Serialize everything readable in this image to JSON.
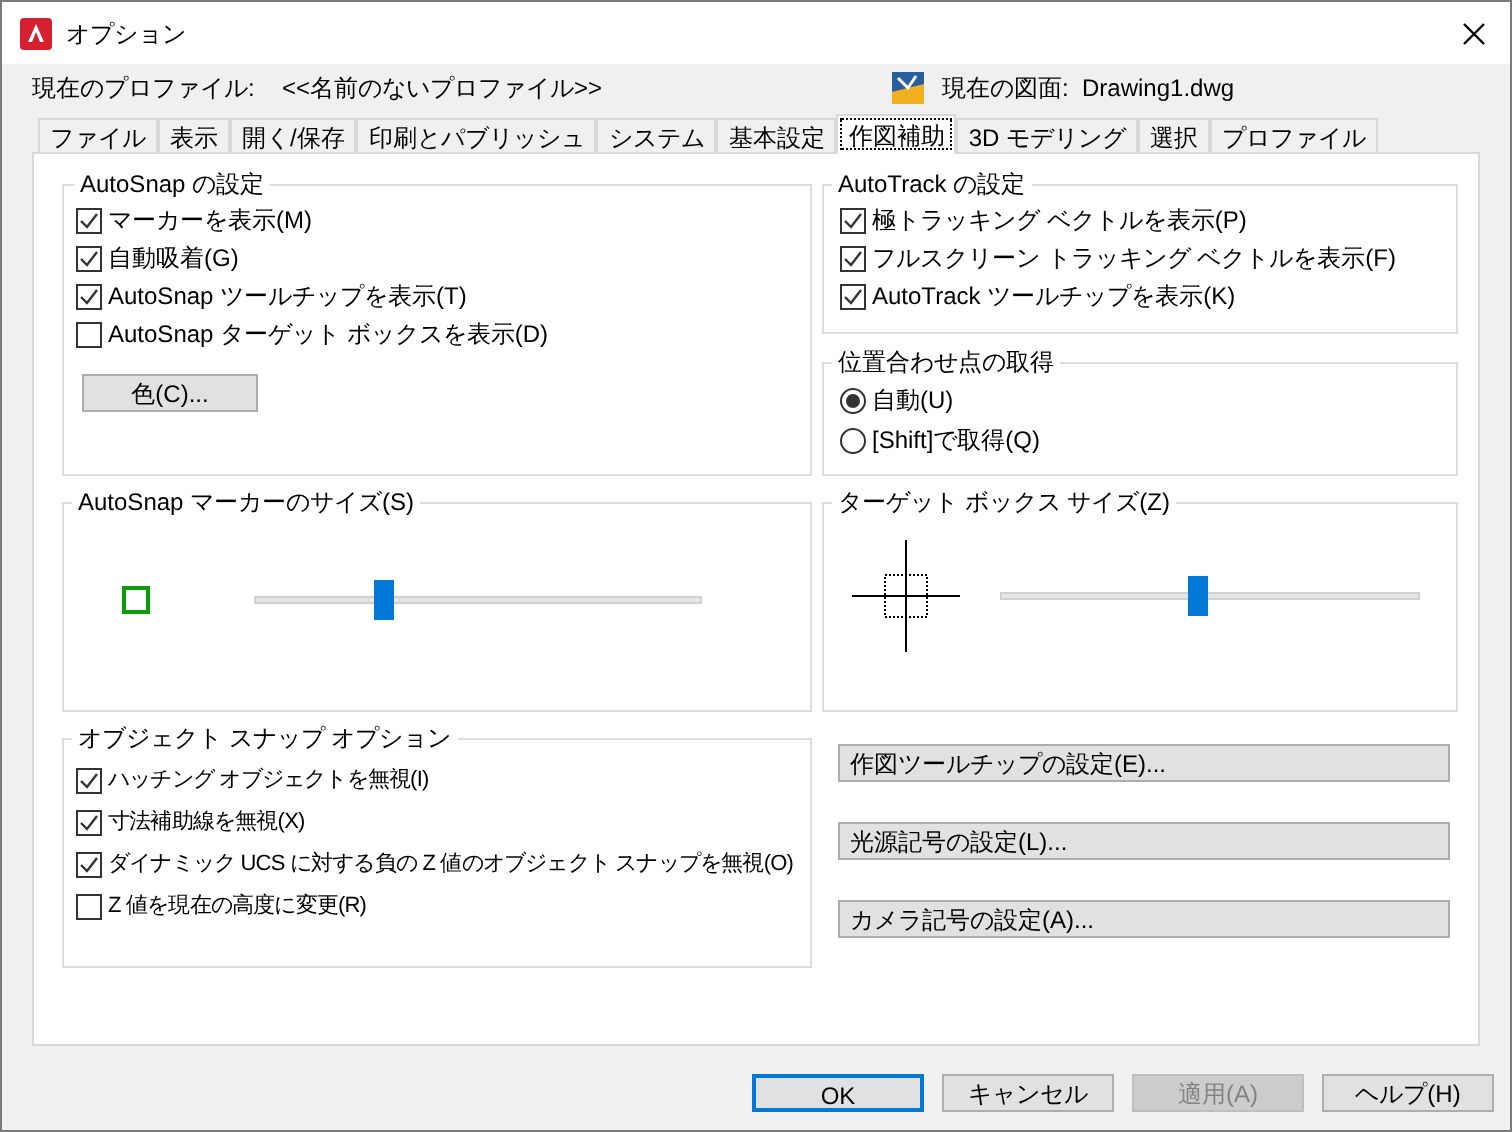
{
  "window": {
    "title": "オプション"
  },
  "profile": {
    "label": "現在のプロファイル:",
    "value": "<<名前のないプロファイル>>"
  },
  "drawing": {
    "label": "現在の図面:",
    "value": "Drawing1.dwg"
  },
  "tabs": [
    {
      "label": "ファイル",
      "selected": false
    },
    {
      "label": "表示",
      "selected": false
    },
    {
      "label": "開く/保存",
      "selected": false
    },
    {
      "label": "印刷とパブリッシュ",
      "selected": false
    },
    {
      "label": "システム",
      "selected": false
    },
    {
      "label": "基本設定",
      "selected": false
    },
    {
      "label": "作図補助",
      "selected": true
    },
    {
      "label": "3D モデリング",
      "selected": false
    },
    {
      "label": "選択",
      "selected": false
    },
    {
      "label": "プロファイル",
      "selected": false
    }
  ],
  "autosnap": {
    "title": "AutoSnap の設定",
    "options": [
      {
        "label": "マーカーを表示(M)",
        "checked": true
      },
      {
        "label": "自動吸着(G)",
        "checked": true
      },
      {
        "label": "AutoSnap ツールチップを表示(T)",
        "checked": true
      },
      {
        "label": "AutoSnap ターゲット ボックスを表示(D)",
        "checked": false
      }
    ],
    "color_button": "色(C)..."
  },
  "autotrack": {
    "title": "AutoTrack の設定",
    "options": [
      {
        "label": "極トラッキング ベクトルを表示(P)",
        "checked": true
      },
      {
        "label": "フルスクリーン トラッキング ベクトルを表示(F)",
        "checked": true
      },
      {
        "label": "AutoTrack ツールチップを表示(K)",
        "checked": true
      }
    ]
  },
  "alignment": {
    "title": "位置合わせ点の取得",
    "options": [
      {
        "label": "自動(U)",
        "selected": true
      },
      {
        "label": "[Shift]で取得(Q)",
        "selected": false
      }
    ]
  },
  "marker_size": {
    "title": "AutoSnap マーカーのサイズ(S)",
    "level": 0.28
  },
  "target_size": {
    "title": "ターゲット ボックス サイズ(Z)",
    "level": 0.47
  },
  "osnap": {
    "title": "オブジェクト スナップ オプション",
    "options": [
      {
        "label": "ハッチング オブジェクトを無視(I)",
        "checked": true
      },
      {
        "label": "寸法補助線を無視(X)",
        "checked": true
      },
      {
        "label": "ダイナミック UCS に対する負の Z 値のオブジェクト スナップを無視(O)",
        "checked": true
      },
      {
        "label": "Z 値を現在の高度に変更(R)",
        "checked": false
      }
    ]
  },
  "settings_buttons": [
    "作図ツールチップの設定(E)...",
    "光源記号の設定(L)...",
    "カメラ記号の設定(A)..."
  ],
  "buttons": [
    {
      "label": "OK",
      "default": true,
      "disabled": false
    },
    {
      "label": "キャンセル",
      "default": false,
      "disabled": false
    },
    {
      "label": "適用(A)",
      "default": false,
      "disabled": true
    },
    {
      "label": "ヘルプ(H)",
      "default": false,
      "disabled": false
    }
  ]
}
